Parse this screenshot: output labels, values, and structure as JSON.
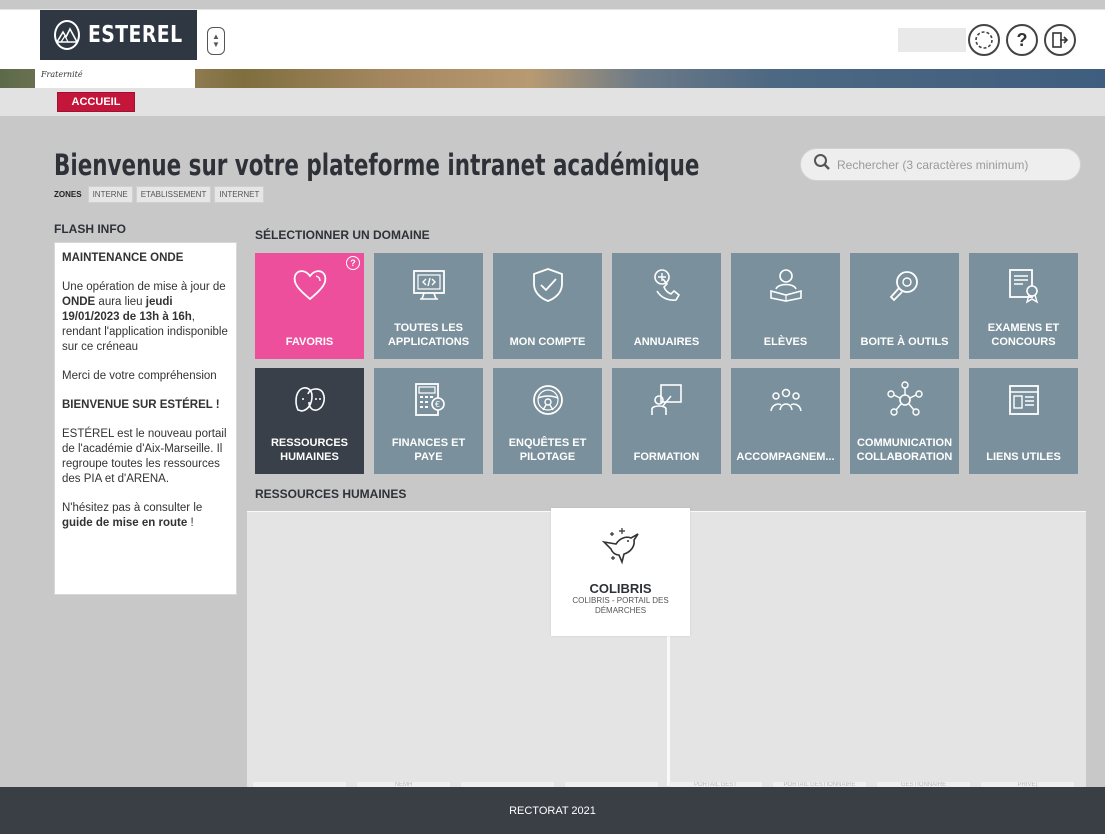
{
  "header": {
    "logo_text": "ESTEREL",
    "fraternite": "Fraternité",
    "icons": [
      "loading-icon",
      "help-icon",
      "logout-icon"
    ]
  },
  "nav": {
    "accueil": "ACCUEIL"
  },
  "page": {
    "title": "Bienvenue sur votre plateforme intranet académique",
    "zones_label": "ZONES",
    "zones": [
      "INTERNE",
      "ETABLISSEMENT",
      "INTERNET"
    ],
    "search_placeholder": "Rechercher (3 caractères minimum)"
  },
  "flash": {
    "title": "FLASH INFO",
    "heading1": "MAINTENANCE ONDE",
    "p1_a": "Une opération de mise à jour de ",
    "p1_b": "ONDE",
    "p1_c": " aura lieu ",
    "p1_d": "jeudi 19/01/2023 de 13h à 16h",
    "p1_e": ", rendant l'application indisponible sur ce créneau",
    "p2": "Merci de votre compréhension",
    "heading2": "BIENVENUE SUR ESTÉREL !",
    "p3": "ESTÉREL est le nouveau portail de l'académie d'Aix-Marseille. Il regroupe toutes les ressources des PIA et d'ARENA.",
    "p4_a": "N'hésitez pas à consulter le ",
    "p4_b": "guide de mise en route",
    "p4_c": " !"
  },
  "domains": {
    "title": "SÉLECTIONNER UN DOMAINE",
    "tiles": [
      {
        "label": "FAVORIS",
        "icon": "heart-icon",
        "help": "?"
      },
      {
        "label": "TOUTES LES APPLICATIONS",
        "icon": "code-screen-icon"
      },
      {
        "label": "MON COMPTE",
        "icon": "shield-check-icon"
      },
      {
        "label": "ANNUAIRES",
        "icon": "phone-icon"
      },
      {
        "label": "ELÈVES",
        "icon": "student-icon"
      },
      {
        "label": "BOITE À OUTILS",
        "icon": "tools-icon"
      },
      {
        "label": "EXAMENS ET CONCOURS",
        "icon": "certificate-icon"
      },
      {
        "label": "RESSOURCES HUMAINES",
        "icon": "people-icon"
      },
      {
        "label": "FINANCES ET PAYE",
        "icon": "calculator-icon"
      },
      {
        "label": "ENQUÊTES ET PILOTAGE",
        "icon": "steering-wheel-icon"
      },
      {
        "label": "FORMATION",
        "icon": "teacher-icon"
      },
      {
        "label": "ACCOMPAGNEM...",
        "icon": "support-icon"
      },
      {
        "label": "COMMUNICATION COLLABORATION",
        "icon": "network-icon"
      },
      {
        "label": "LIENS UTILES",
        "icon": "links-icon"
      }
    ]
  },
  "rh": {
    "title": "RESSOURCES HUMAINES",
    "app_name": "COLIBRIS",
    "app_desc": "COLIBRIS - PORTAIL DES DÉMARCHES",
    "app_icon": "hummingbird-icon",
    "faded_labels": [
      "",
      "NEMH",
      "",
      "",
      "PORTAIL GEST",
      "PORTAIL GESTIONNAIRE",
      "GESTIONNAIRE",
      "PRIVE)"
    ]
  },
  "footer": {
    "text": "RECTORAT 2021"
  },
  "colors": {
    "header_bg": "#2f3742",
    "accent_red": "#c4153a",
    "tile": "#7a909c",
    "tile_favoris": "#ee4f9d",
    "tile_active": "#3a4049",
    "footer_bg": "#3a3f46"
  }
}
